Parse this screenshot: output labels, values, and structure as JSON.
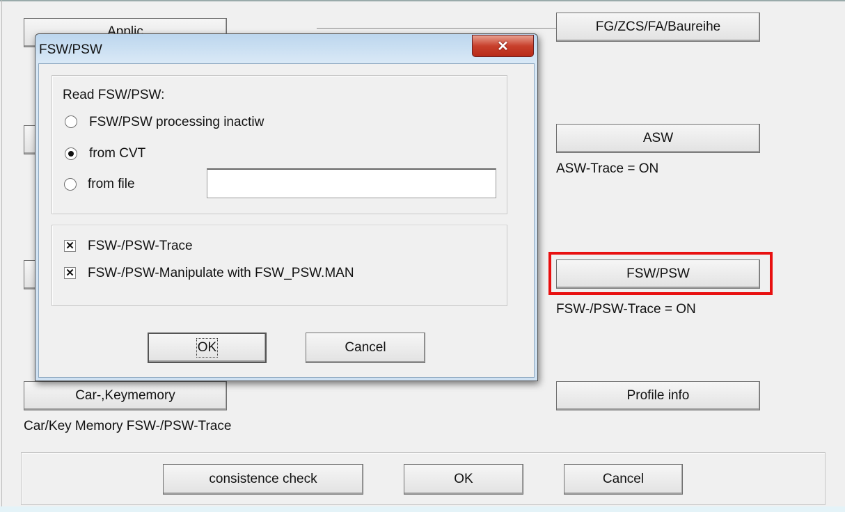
{
  "main": {
    "applic_label": "Applic",
    "fg_button": "FG/ZCS/FA/Baureihe",
    "asw_button": "ASW",
    "asw_status": "ASW-Trace = ON",
    "fsw_button": "FSW/PSW",
    "fsw_status": "FSW-/PSW-Trace = ON",
    "profile_button": "Profile info",
    "carkey_button": "Car-,Keymemory",
    "carkey_status": "Car/Key Memory FSW-/PSW-Trace",
    "consistence_button": "consistence check",
    "ok_button": "OK",
    "cancel_button": "Cancel",
    "highlight_color": "#e81010"
  },
  "dialog": {
    "title": "FSW/PSW",
    "close_icon": "close-icon",
    "read_label": "Read FSW/PSW:",
    "radio_options": [
      {
        "label": "FSW/PSW processing inactiw",
        "checked": false
      },
      {
        "label": "from CVT",
        "checked": true
      },
      {
        "label": "from file",
        "checked": false
      }
    ],
    "file_input_value": "",
    "checkboxes": [
      {
        "label": "FSW-/PSW-Trace",
        "checked": true
      },
      {
        "label": "FSW-/PSW-Manipulate with FSW_PSW.MAN",
        "checked": true
      }
    ],
    "ok_button": "OK",
    "cancel_button": "Cancel"
  }
}
